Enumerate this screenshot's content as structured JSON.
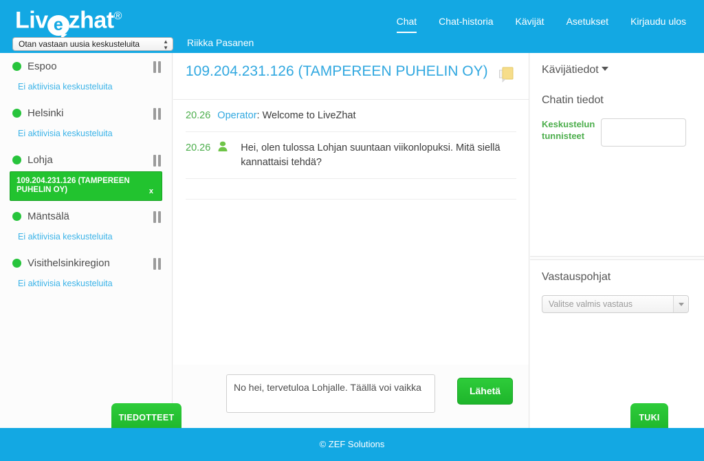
{
  "header": {
    "logo_part1": "Liv",
    "logo_bubble": "e",
    "logo_part2": "zhat",
    "logo_reg": "®",
    "status_value": "Otan vastaan uusia keskusteluita",
    "agent_name": "Riikka Pasanen",
    "nav": [
      {
        "label": "Chat",
        "active": true
      },
      {
        "label": "Chat-historia",
        "active": false
      },
      {
        "label": "Kävijät",
        "active": false
      },
      {
        "label": "Asetukset",
        "active": false
      },
      {
        "label": "Kirjaudu ulos",
        "active": false
      }
    ]
  },
  "sidebar": {
    "sites": [
      {
        "name": "Espoo",
        "status": "online",
        "empty_text": "Ei aktiivisia keskusteluita",
        "chats": []
      },
      {
        "name": "Helsinki",
        "status": "online",
        "empty_text": "Ei aktiivisia keskusteluita",
        "chats": []
      },
      {
        "name": "Lohja",
        "status": "online",
        "empty_text": "",
        "chats": [
          {
            "label": "109.204.231.126 (TAMPEREEN PUHELIN OY)",
            "close_label": "x",
            "selected": true
          }
        ]
      },
      {
        "name": "Mäntsälä",
        "status": "online",
        "empty_text": "Ei aktiivisia keskusteluita",
        "chats": []
      },
      {
        "name": "Visithelsinkiregion",
        "status": "online",
        "empty_text": "Ei aktiivisia keskusteluita",
        "chats": []
      }
    ]
  },
  "chat": {
    "title": "109.204.231.126 (TAMPEREEN PUHELIN OY)",
    "note_icon": "sticky-note-icon",
    "messages": [
      {
        "time": "20.26",
        "sender": "Operator",
        "sender_suffix": ":",
        "text": "Welcome to LiveZhat",
        "type": "operator"
      },
      {
        "time": "20.26",
        "sender": "",
        "sender_suffix": "",
        "text": "Hei, olen tulossa Lohjan suuntaan viikonlopuksi. Mitä siellä kannattaisi tehdä?",
        "type": "visitor"
      }
    ]
  },
  "composer": {
    "message_value": "No hei, tervetuloa Lohjalle. Täällä voi vaikka",
    "placeholder": "",
    "send_label": "Lähetä"
  },
  "right": {
    "visitor_info_title": "Kävijätiedot",
    "chat_info_title": "Chatin tiedot",
    "tags_label": "Keskustelun tunnisteet",
    "tags_value": "",
    "templates_title": "Vastauspohjat",
    "template_placeholder": "Valitse valmis vastaus"
  },
  "bottom": {
    "tiedotteet_label": "TIEDOTTEET",
    "tuki_label": "TUKI"
  },
  "footer": {
    "text": "© ZEF Solutions"
  },
  "colors": {
    "brand_blue": "#13a8e3",
    "link_blue": "#31a8e0",
    "green": "#22c32f",
    "status_green": "#27c43c",
    "time_green": "#4cae4c"
  }
}
